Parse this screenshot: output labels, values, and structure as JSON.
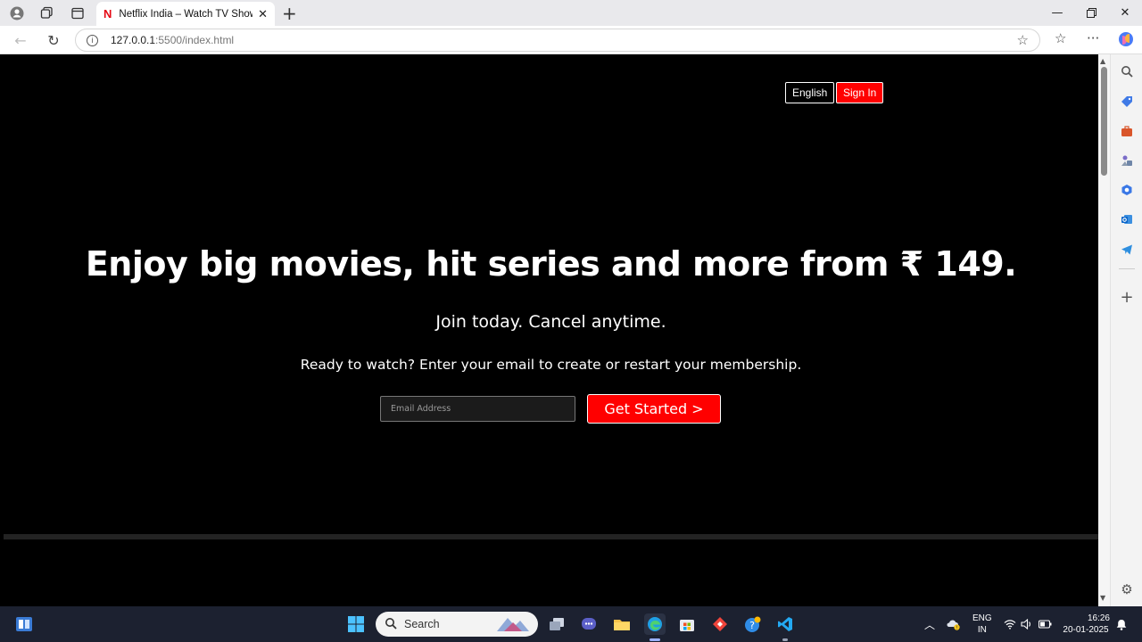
{
  "browser": {
    "tab_title": "Netflix India – Watch TV Shows O",
    "tab_favicon": "N",
    "url_host": "127.0.0.1",
    "url_path": ":5500/index.html"
  },
  "page": {
    "language_button": "English",
    "signin_button": "Sign In",
    "headline": "Enjoy big movies, hit series and more from ₹ 149.",
    "subheadline": "Join today. Cancel anytime.",
    "cta_text": "Ready to watch? Enter your email to create or restart your membership.",
    "email_placeholder": "Email Address",
    "get_started_button": "Get Started >"
  },
  "taskbar": {
    "search_placeholder": "Search",
    "lang_line1": "ENG",
    "lang_line2": "IN",
    "time": "16:26",
    "date": "20-01-2025"
  },
  "colors": {
    "brand_red": "#ff0000",
    "page_bg": "#000000"
  }
}
